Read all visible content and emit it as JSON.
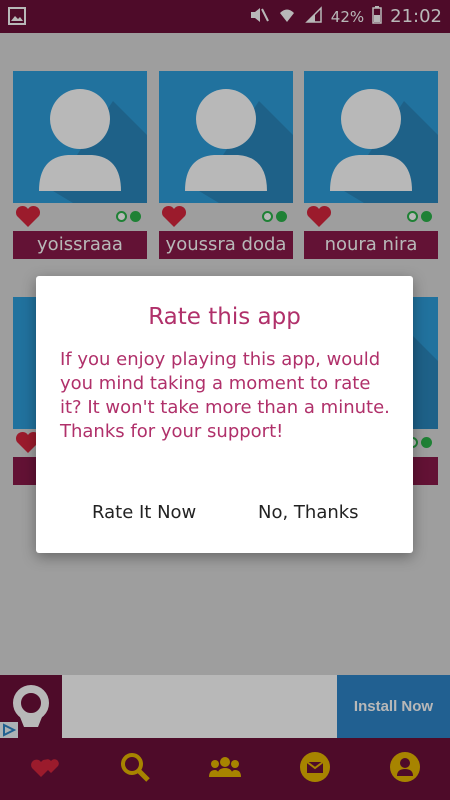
{
  "status_bar": {
    "battery": "42%",
    "time": "21:02"
  },
  "users": [
    {
      "name": "yoissraaa"
    },
    {
      "name": "youssra doda"
    },
    {
      "name": "noura nira"
    },
    {
      "name": ""
    },
    {
      "name": ""
    },
    {
      "name": ""
    }
  ],
  "dialog": {
    "title": "Rate this app",
    "message": "If you enjoy playing this app, would you mind taking a moment to rate it? It won't take more than a minute. Thanks for your support!",
    "rate_label": "Rate It Now",
    "decline_label": "No, Thanks"
  },
  "ad": {
    "install_label": "Install Now"
  },
  "colors": {
    "primary": "#6d1039",
    "accent": "#b0306a",
    "avatar_bg": "#2f9fdb",
    "online": "#2bb34a",
    "nav_icon": "#e8b800"
  },
  "bottom_nav": [
    {
      "icon": "hearts-icon"
    },
    {
      "icon": "search-icon"
    },
    {
      "icon": "group-icon"
    },
    {
      "icon": "mail-icon"
    },
    {
      "icon": "profile-icon"
    }
  ]
}
